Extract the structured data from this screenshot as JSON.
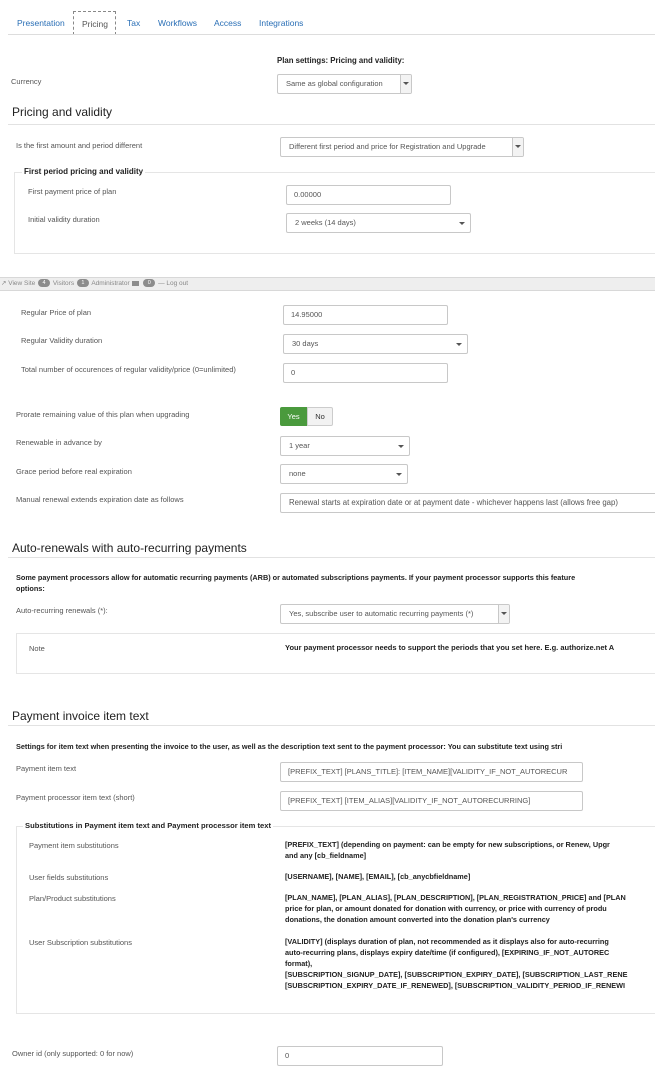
{
  "tabs": [
    {
      "label": "Presentation"
    },
    {
      "label": "Pricing"
    },
    {
      "label": "Tax"
    },
    {
      "label": "Workflows"
    },
    {
      "label": "Access"
    },
    {
      "label": "Integrations"
    }
  ],
  "plan_settings_heading": "Plan settings: Pricing and validity:",
  "currency": {
    "label": "Currency",
    "value": "Same as global configuration"
  },
  "pricing_validity": {
    "title": "Pricing and validity",
    "first_different": {
      "label": "Is the first amount and period different",
      "value": "Different first period and price for Registration and Upgrade"
    },
    "first_period": {
      "legend": "First period pricing and validity",
      "price": {
        "label": "First payment price of plan",
        "value": "0.00000"
      },
      "duration": {
        "label": "Initial validity duration",
        "value": "2 weeks (14 days)"
      }
    }
  },
  "admin_bar": {
    "view_site": "View Site",
    "visitors_count": "4",
    "visitors": "Visitors",
    "admins_count": "1",
    "administrator": "Administrator",
    "messages_count": "0",
    "logout": "Log out"
  },
  "regular": {
    "price": {
      "label": "Regular Price of plan",
      "value": "14.95000"
    },
    "validity": {
      "label": "Regular Validity duration",
      "value": "30 days"
    },
    "occurrences": {
      "label": "Total number of occurences of regular validity/price (0=unlimited)",
      "value": "0"
    }
  },
  "prorate": {
    "label": "Prorate remaining value of this plan when upgrading",
    "yes": "Yes",
    "no": "No"
  },
  "renewable": {
    "label": "Renewable in advance by",
    "value": "1 year"
  },
  "grace": {
    "label": "Grace period before real expiration",
    "value": "none"
  },
  "manual_renewal": {
    "label": "Manual renewal extends expiration date as follows",
    "value": "Renewal starts at expiration date or at payment date - whichever happens last (allows free gap)"
  },
  "auto_renewals": {
    "title": "Auto-renewals with auto-recurring payments",
    "description_line1": "Some payment processors allow for automatic recurring payments (ARB) or automated subscriptions payments. If your payment processor supports this feature",
    "description_line2": "options:",
    "field": {
      "label": "Auto-recurring renewals (*):",
      "value": "Yes, subscribe user to automatic recurring payments (*)"
    },
    "note_label": "Note",
    "note_text": "Your payment processor needs to support the periods that you set here. E.g. authorize.net A"
  },
  "invoice": {
    "title": "Payment invoice item text",
    "description": "Settings for item text when presenting the invoice to the user, as well as the description text sent to the payment processor: You can substitute text using stri",
    "item_text": {
      "label": "Payment item text",
      "value": "[PREFIX_TEXT] [PLANS_TITLE]: [ITEM_NAME][VALIDITY_IF_NOT_AUTORECUR"
    },
    "processor_text": {
      "label": "Payment processor item text (short)",
      "value": "[PREFIX_TEXT] [ITEM_ALIAS][VALIDITY_IF_NOT_AUTORECURRING]"
    },
    "subs_legend": "Substitutions in Payment item text and Payment processor item text",
    "subs": [
      {
        "label": "Payment item substitutions",
        "lines": [
          "[PREFIX_TEXT] (depending on payment: can be empty for new subscriptions, or Renew, Upgr",
          "and any [cb_fieldname]"
        ]
      },
      {
        "label": "User fields substitutions",
        "lines": [
          "[USERNAME], [NAME], [EMAIL], [cb_anycbfieldname]"
        ]
      },
      {
        "label": "Plan/Product substitutions",
        "lines": [
          "[PLAN_NAME], [PLAN_ALIAS], [PLAN_DESCRIPTION], [PLAN_REGISTRATION_PRICE] and [PLAN",
          "price for plan, or amount donated for donation with currency, or price with currency of produ",
          "donations, the donation amount converted into the donation plan's currency"
        ]
      },
      {
        "label": "User Subscription substitutions",
        "lines": [
          "[VALIDITY] (displays duration of plan, not recommended as it displays also for auto-recurring",
          "auto-recurring plans, displays expiry date/time (if configured), [EXPIRING_IF_NOT_AUTOREC",
          "format),",
          "[SUBSCRIPTION_SIGNUP_DATE], [SUBSCRIPTION_EXPIRY_DATE], [SUBSCRIPTION_LAST_RENE",
          "[SUBSCRIPTION_EXPIRY_DATE_IF_RENEWED], [SUBSCRIPTION_VALIDITY_PERIOD_IF_RENEWI"
        ]
      }
    ]
  },
  "owner": {
    "label": "Owner id (only supported: 0 for now)",
    "value": "0"
  }
}
